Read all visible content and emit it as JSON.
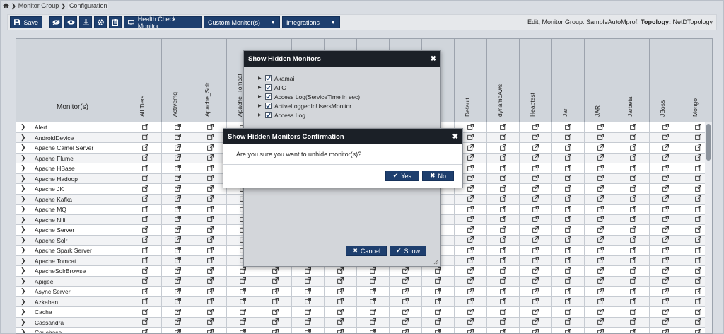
{
  "breadcrumb": {
    "items": [
      "Monitor Group",
      "Configuration"
    ]
  },
  "toolbar": {
    "save_label": "Save",
    "health_check_label": "Health Check Monitor",
    "custom_monitors_label": "Custom Monitor(s)",
    "integrations_label": "Integrations",
    "info_prefix": "Edit, Monitor Group:",
    "info_group": "SampleAutoMprof,",
    "info_topology_label": "Topology:",
    "info_topology": "NetDTopology"
  },
  "grid": {
    "monitor_header": "Monitor(s)",
    "columns": [
      "All Tiers",
      "Activemq",
      "Apache_Solr",
      "Apache_Tomcat",
      "",
      "",
      "",
      "",
      "",
      "",
      "Default",
      "dynamoAws",
      "Heaptest",
      "Jar",
      "JAR",
      "Jarbeta",
      "JBoss",
      "Mongo"
    ],
    "rows": [
      "Alert",
      "AndroidDevice",
      "Apache Camel Server",
      "Apache Flume",
      "Apache HBase",
      "Apache Hadoop",
      "Apache JK",
      "Apache Kafka",
      "Apache MQ",
      "Apache Nifi",
      "Apache Server",
      "Apache Solr",
      "Apache Spark Server",
      "Apache Tomcat",
      "ApacheSolrBrowse",
      "Apigee",
      "Async Server",
      "Azkaban",
      "Cache",
      "Cassandra",
      "Couchase"
    ]
  },
  "hidden_dialog": {
    "title": "Show Hidden Monitors",
    "items": [
      "Akamai",
      "ATG",
      "Access Log(ServiceTime in sec)",
      "ActiveLoggedInUsersMonitor",
      "Access Log"
    ],
    "cancel_label": "Cancel",
    "show_label": "Show"
  },
  "confirm_dialog": {
    "title": "Show Hidden Monitors Confirmation",
    "message": "Are you sure you want to unhide monitor(s)?",
    "yes_label": "Yes",
    "no_label": "No"
  },
  "colors": {
    "primary_button": "#1e3f6e",
    "dialog_title": "#1b2027"
  }
}
